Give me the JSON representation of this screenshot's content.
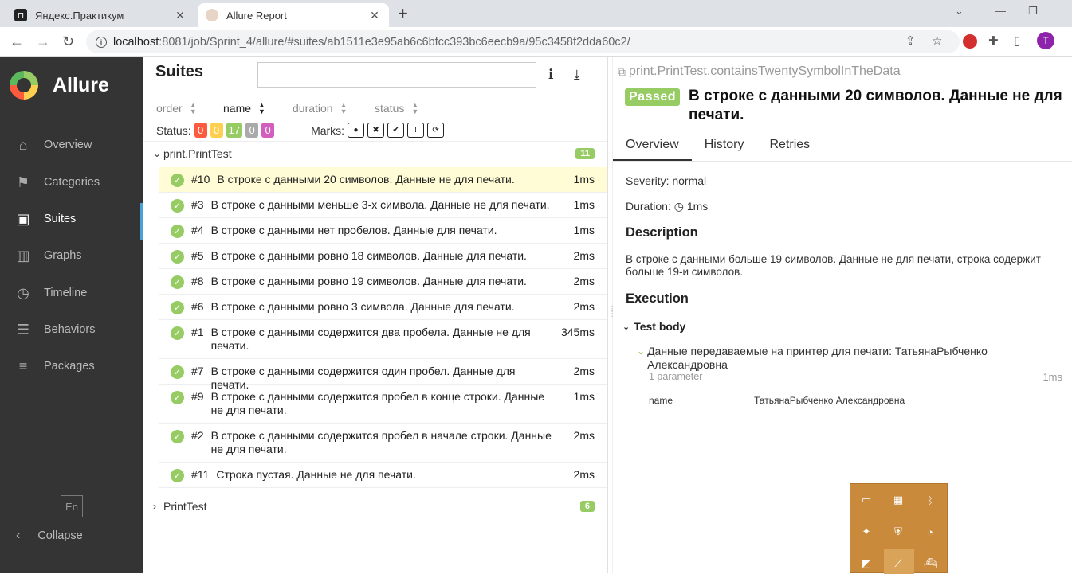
{
  "browser": {
    "tabs": [
      {
        "title": "Яндекс.Практикум",
        "active": false
      },
      {
        "title": "Allure Report",
        "active": true
      }
    ],
    "url_host": "localhost",
    "url_path": ":8081/job/Sprint_4/allure/#suites/ab1511e3e95ab6c6bfcc393bc6eecb9a/95c3458f2dda60c2/",
    "profile_initial": "T"
  },
  "sidebar": {
    "brand": "Allure",
    "items": [
      {
        "label": "Overview",
        "icon": "home-icon"
      },
      {
        "label": "Categories",
        "icon": "flag-icon"
      },
      {
        "label": "Suites",
        "icon": "briefcase-icon",
        "active": true
      },
      {
        "label": "Graphs",
        "icon": "bar-chart-icon"
      },
      {
        "label": "Timeline",
        "icon": "clock-icon"
      },
      {
        "label": "Behaviors",
        "icon": "list-icon"
      },
      {
        "label": "Packages",
        "icon": "align-left-icon"
      }
    ],
    "language": "En",
    "collapse": "Collapse"
  },
  "suites": {
    "title": "Suites",
    "search_placeholder": "",
    "sort": {
      "order": "order",
      "name": "name",
      "duration": "duration",
      "status": "status"
    },
    "status_label": "Status:",
    "status_counts": [
      {
        "value": "0",
        "color": "#fd5a3e"
      },
      {
        "value": "0",
        "color": "#ffd050"
      },
      {
        "value": "17",
        "color": "#97cc64"
      },
      {
        "value": "0",
        "color": "#aaaaaa"
      },
      {
        "value": "0",
        "color": "#d35ebe"
      }
    ],
    "marks_label": "Marks:",
    "groups": [
      {
        "name": "print.PrintTest",
        "count": "11",
        "expanded": true
      },
      {
        "name": "PrintTest",
        "count": "6",
        "expanded": false
      }
    ],
    "tests": [
      {
        "num": "#10",
        "name": "В строке с данными 20 символов. Данные не для печати.",
        "duration": "1ms",
        "selected": true
      },
      {
        "num": "#3",
        "name": "В строке с данными меньше 3-х символа. Данные не для печати.",
        "duration": "1ms"
      },
      {
        "num": "#4",
        "name": "В строке с данными нет пробелов. Данные для печати.",
        "duration": "1ms"
      },
      {
        "num": "#5",
        "name": "В строке с данными ровно 18 символов. Данные для печати.",
        "duration": "2ms"
      },
      {
        "num": "#8",
        "name": "В строке с данными ровно 19 символов. Данные для печати.",
        "duration": "2ms"
      },
      {
        "num": "#6",
        "name": "В строке с данными ровно 3 символа. Данные для печати.",
        "duration": "2ms"
      },
      {
        "num": "#1",
        "name": "В строке с данными содержится два пробела. Данные не для печати.",
        "duration": "345ms"
      },
      {
        "num": "#7",
        "name": "В строке с данными содержится один пробел. Данные для печати.",
        "duration": "2ms"
      },
      {
        "num": "#9",
        "name": "В строке с данными содержится пробел в конце строки. Данные не для печати.",
        "duration": "1ms"
      },
      {
        "num": "#2",
        "name": "В строке с данными содержится пробел в начале строки. Данные не для печати.",
        "duration": "2ms"
      },
      {
        "num": "#11",
        "name": "Строка пустая. Данные не для печати.",
        "duration": "2ms"
      }
    ]
  },
  "detail": {
    "path": "print.PrintTest.containsTwentySymbolInTheData",
    "status": "Passed",
    "title": "В строке с данными 20 символов. Данные не для печати.",
    "tabs": [
      "Overview",
      "History",
      "Retries"
    ],
    "severity": "Severity: normal",
    "duration_label": "Duration:",
    "duration_value": "1ms",
    "description_heading": "Description",
    "description": "В строке с данными больше 19 символов. Данные не для печати, строка содержит больше 19-и символов.",
    "execution_heading": "Execution",
    "test_body": "Test body",
    "step_name": "Данные передаваемые на принтер для печати: ТатьянаРыбченко Александровна",
    "param_count": "1 parameter",
    "step_duration": "1ms",
    "param_name": "name",
    "param_value": "ТатьянаРыбченко Александровна"
  },
  "colors": {
    "passed": "#97cc64",
    "sidebar": "#343434",
    "accent": "#49a1d7"
  }
}
